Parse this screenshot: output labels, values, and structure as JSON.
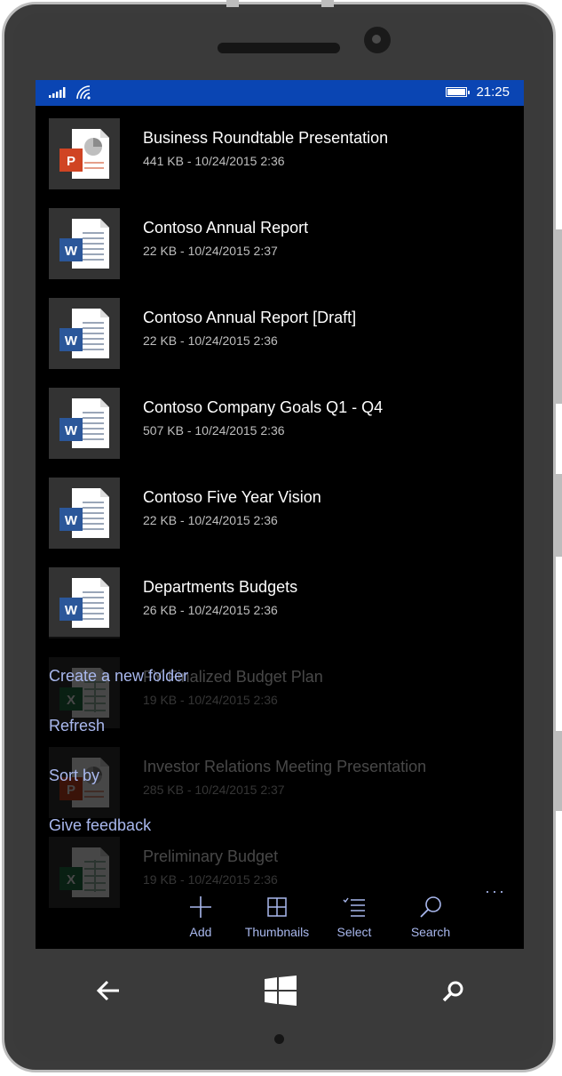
{
  "status_bar": {
    "time": "21:25"
  },
  "files": [
    {
      "title": "Business Roundtable Presentation",
      "meta": "441 KB - 10/24/2015 2:36",
      "type": "powerpoint"
    },
    {
      "title": "Contoso Annual Report",
      "meta": "22 KB - 10/24/2015 2:37",
      "type": "word"
    },
    {
      "title": "Contoso Annual Report [Draft]",
      "meta": "22 KB - 10/24/2015 2:36",
      "type": "word"
    },
    {
      "title": "Contoso Company Goals Q1 - Q4",
      "meta": "507 KB - 10/24/2015 2:36",
      "type": "word"
    },
    {
      "title": "Contoso Five Year Vision",
      "meta": "22 KB - 10/24/2015 2:36",
      "type": "word"
    },
    {
      "title": "Departments Budgets",
      "meta": "26 KB - 10/24/2015 2:36",
      "type": "word"
    },
    {
      "title": "FY Finalized Budget Plan",
      "meta": "19 KB - 10/24/2015 2:36",
      "type": "excel"
    },
    {
      "title": "Investor Relations Meeting Presentation",
      "meta": "285 KB - 10/24/2015 2:37",
      "type": "powerpoint"
    },
    {
      "title": "Preliminary Budget",
      "meta": "19 KB - 10/24/2015 2:36",
      "type": "excel"
    }
  ],
  "overflow_menu": {
    "items": [
      "Create a new folder",
      "Refresh",
      "Sort by",
      "Give feedback"
    ]
  },
  "app_bar": {
    "add": "Add",
    "thumbnails": "Thumbnails",
    "select": "Select",
    "search": "Search",
    "more": "···"
  },
  "nav_bar": {
    "back_icon": "back-arrow-icon",
    "home_icon": "windows-logo-icon",
    "search_icon": "search-icon"
  },
  "colors": {
    "status_bar": "#0a45b3",
    "accent_text": "#a9b8ee",
    "word": "#2b579a",
    "powerpoint": "#d04423",
    "excel": "#217346"
  }
}
